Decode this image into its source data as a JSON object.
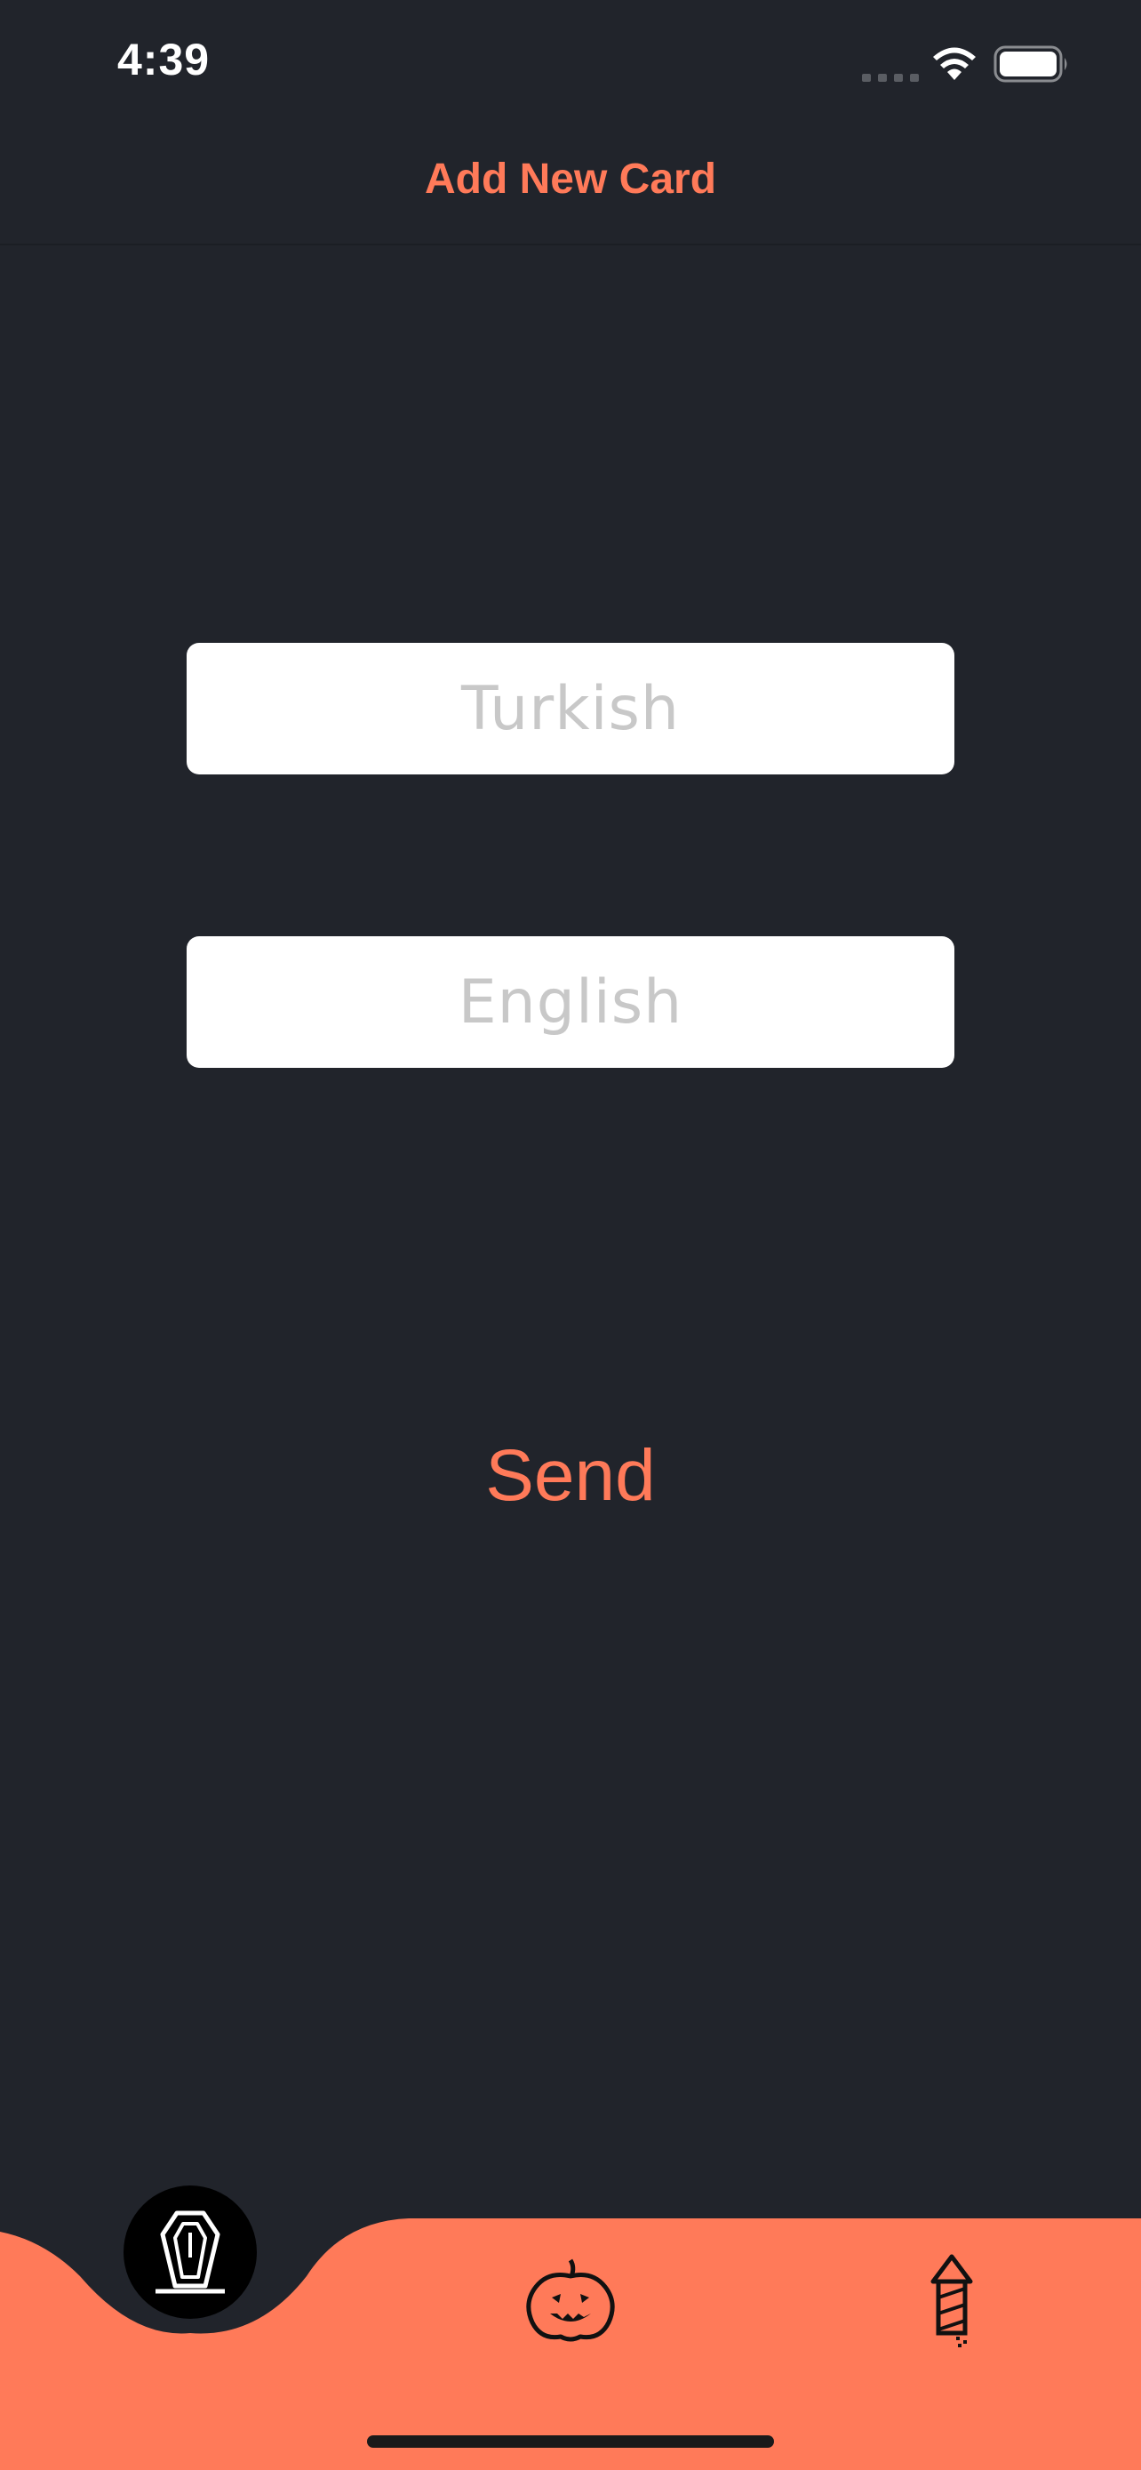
{
  "status_bar": {
    "time": "4:39"
  },
  "nav": {
    "title": "Add New Card"
  },
  "form": {
    "turkish_placeholder": "Turkish",
    "english_placeholder": "English",
    "send_label": "Send"
  },
  "tab_bar": {
    "items": [
      {
        "icon": "coffin-icon",
        "active": true
      },
      {
        "icon": "pumpkin-icon",
        "active": false
      },
      {
        "icon": "firework-rocket-icon",
        "active": false
      }
    ]
  },
  "colors": {
    "background": "#21242b",
    "accent": "#ff7a59",
    "field": "#ffffff",
    "placeholder": "#c8c8c8"
  }
}
